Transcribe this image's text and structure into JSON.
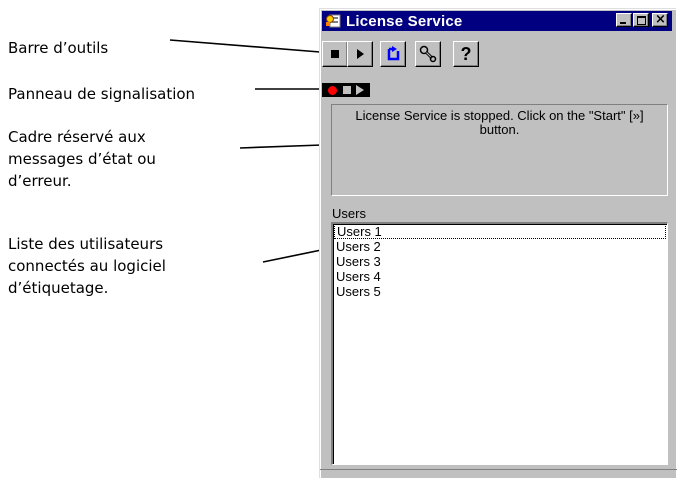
{
  "annotations": {
    "toolbar": "Barre d’outils",
    "signal_panel": "Panneau de signalisation",
    "status_frame": [
      "Cadre réservé aux",
      "messages d’état ou",
      "d’erreur."
    ],
    "users_list": [
      "Liste des utilisateurs",
      "connectés au logiciel",
      "d’étiquetage."
    ]
  },
  "window": {
    "title": "License Service",
    "titlebar_color": "#000080",
    "caption_buttons": [
      "minimize-icon",
      "maximize-icon",
      "close-icon"
    ]
  },
  "toolbar": {
    "buttons": [
      {
        "name": "stop",
        "icon": "stop-square-icon"
      },
      {
        "name": "start",
        "icon": "play-triangle-icon"
      },
      {
        "name": "refresh",
        "icon": "refresh-icon",
        "color": "#0000ff"
      },
      {
        "name": "settings",
        "icon": "wrench-icon"
      },
      {
        "name": "help",
        "label": "?"
      }
    ]
  },
  "signal_panel": {
    "indicators": [
      "record-dot-icon",
      "stop-square-icon",
      "play-triangle-icon"
    ],
    "active_color": "#ff0000"
  },
  "status": {
    "message": "License Service is stopped. Click on the \"Start\" [»] button."
  },
  "users": {
    "label": "Users",
    "items": [
      "Users 1",
      "Users 2",
      "Users 3",
      "Users 4",
      "Users 5"
    ]
  }
}
